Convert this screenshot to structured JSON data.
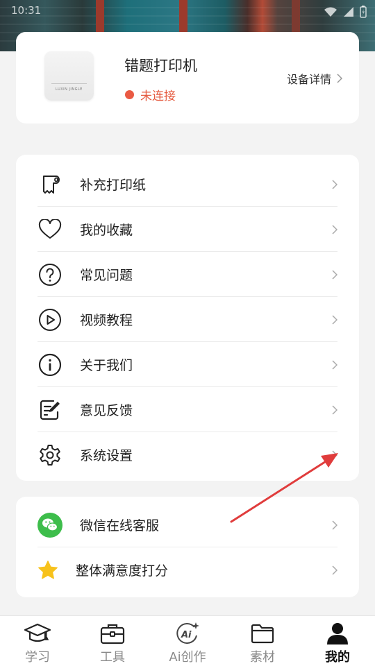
{
  "status_bar": {
    "time": "10:31"
  },
  "device": {
    "name": "错题打印机",
    "brand_mark": "LUXIN JINGLE",
    "status": "未连接",
    "status_color": "#ea5a43",
    "detail_label": "设备详情"
  },
  "menu": [
    {
      "label": "补充打印纸",
      "icon": "paper-roll-icon"
    },
    {
      "label": "我的收藏",
      "icon": "heart-icon"
    },
    {
      "label": "常见问题",
      "icon": "question-circle-icon"
    },
    {
      "label": "视频教程",
      "icon": "play-circle-icon"
    },
    {
      "label": "关于我们",
      "icon": "info-circle-icon"
    },
    {
      "label": "意见反馈",
      "icon": "feedback-edit-icon"
    },
    {
      "label": "系统设置",
      "icon": "gear-icon"
    }
  ],
  "support": [
    {
      "label": "微信在线客服",
      "icon": "wechat-icon",
      "color": "#3dbd4b"
    },
    {
      "label": "整体满意度打分",
      "icon": "star-icon",
      "color": "#f7c21c"
    }
  ],
  "tabs": [
    {
      "label": "学习",
      "icon": "graduation-cap-icon"
    },
    {
      "label": "工具",
      "icon": "toolbox-icon"
    },
    {
      "label": "Ai创作",
      "icon": "ai-sparkle-icon"
    },
    {
      "label": "素材",
      "icon": "folder-icon"
    },
    {
      "label": "我的",
      "icon": "user-icon",
      "active": true
    }
  ],
  "annotation_color": "#e03c3c"
}
